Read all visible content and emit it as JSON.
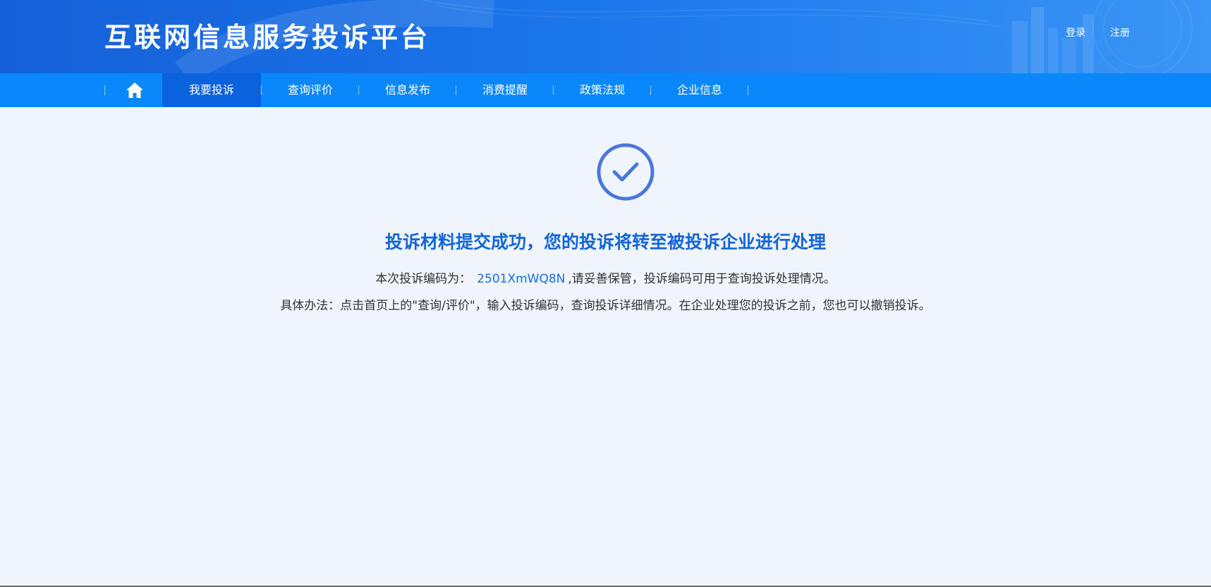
{
  "header": {
    "title": "互联网信息服务投诉平台",
    "login_label": "登录",
    "register_label": "注册"
  },
  "nav": {
    "home_icon": "home-icon",
    "items": [
      {
        "label": "我要投诉",
        "active": true
      },
      {
        "label": "查询评价",
        "active": false
      },
      {
        "label": "信息发布",
        "active": false
      },
      {
        "label": "消费提醒",
        "active": false
      },
      {
        "label": "政策法规",
        "active": false
      },
      {
        "label": "企业信息",
        "active": false
      }
    ]
  },
  "result": {
    "icon": "check-circle-icon",
    "title": "投诉材料提交成功，您的投诉将转至被投诉企业进行处理",
    "code_prefix": "本次投诉编码为：",
    "code": "2501XmWQ8N",
    "code_suffix": ",请妥善保管，投诉编码可用于查询投诉处理情况。",
    "instructions": "具体办法：点击首页上的\"查询/评价\"，输入投诉编码，查询投诉详细情况。在企业处理您的投诉之前，您也可以撤销投诉。"
  },
  "colors": {
    "header_bg": "#1a6fe6",
    "nav_bg": "#0a87fb",
    "nav_active": "#0a62dc",
    "accent": "#1466d6",
    "page_bg": "#eff4fd",
    "check": "#4a77dc"
  }
}
